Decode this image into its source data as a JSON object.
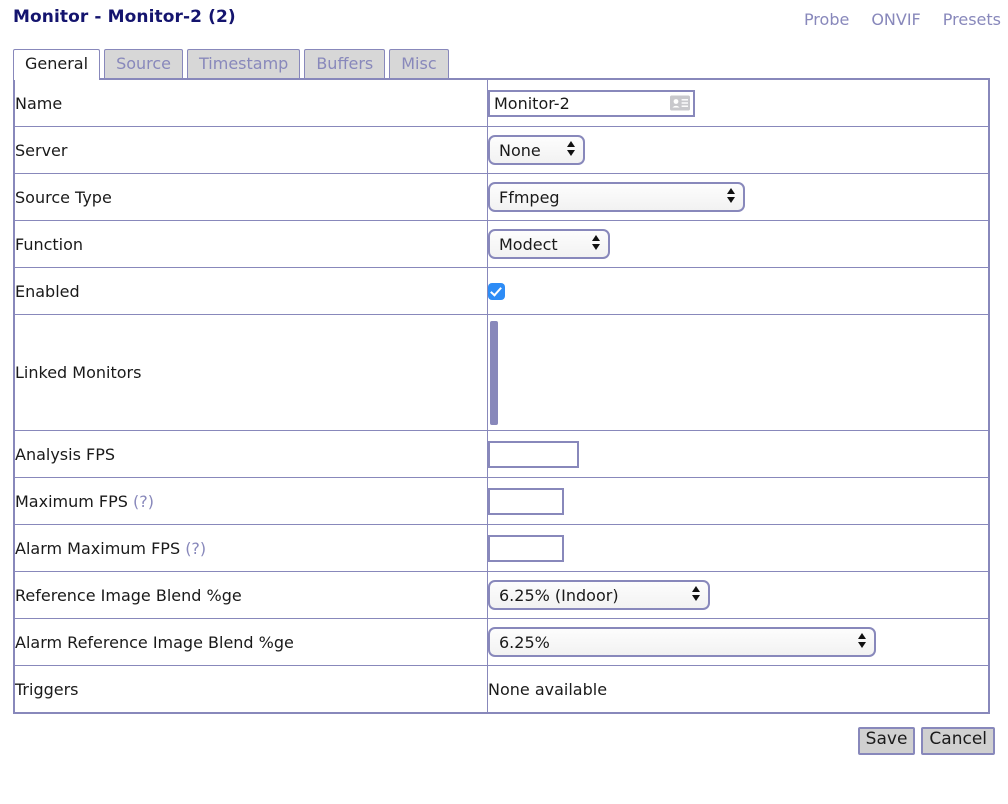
{
  "header": {
    "title": "Monitor - Monitor-2 (2)",
    "links": [
      {
        "label": "Probe",
        "name": "probe-link"
      },
      {
        "label": "ONVIF",
        "name": "onvif-link"
      },
      {
        "label": "Presets",
        "name": "presets-link"
      }
    ]
  },
  "tabs": [
    {
      "label": "General",
      "active": true
    },
    {
      "label": "Source",
      "active": false
    },
    {
      "label": "Timestamp",
      "active": false
    },
    {
      "label": "Buffers",
      "active": false
    },
    {
      "label": "Misc",
      "active": false
    }
  ],
  "form": {
    "name": {
      "label": "Name",
      "value": "Monitor-2",
      "placeholder": ""
    },
    "server": {
      "label": "Server",
      "value": "None"
    },
    "source_type": {
      "label": "Source Type",
      "value": "Ffmpeg"
    },
    "function": {
      "label": "Function",
      "value": "Modect"
    },
    "enabled": {
      "label": "Enabled",
      "checked": true
    },
    "linked_monitors": {
      "label": "Linked Monitors",
      "value": ""
    },
    "analysis_fps": {
      "label": "Analysis FPS",
      "value": "",
      "placeholder": ""
    },
    "maximum_fps": {
      "label": "Maximum FPS",
      "help": "(?)",
      "value": "",
      "placeholder": ""
    },
    "alarm_maximum_fps": {
      "label": "Alarm Maximum FPS",
      "help": "(?)",
      "value": "",
      "placeholder": ""
    },
    "reference_blend": {
      "label": "Reference Image Blend %ge",
      "value": "6.25% (Indoor)"
    },
    "alarm_reference_blend": {
      "label": "Alarm Reference Image Blend %ge",
      "value": "6.25%"
    },
    "triggers": {
      "label": "Triggers",
      "value": "None available"
    }
  },
  "footer": {
    "save_label": "Save",
    "cancel_label": "Cancel"
  },
  "colors": {
    "title": "#14146e",
    "border": "#8888bb",
    "link": "#8888bb",
    "checkbox": "#2d8cf6",
    "tab_inactive_bg": "#d7d7d7",
    "button_bg": "#d0d0d0"
  }
}
